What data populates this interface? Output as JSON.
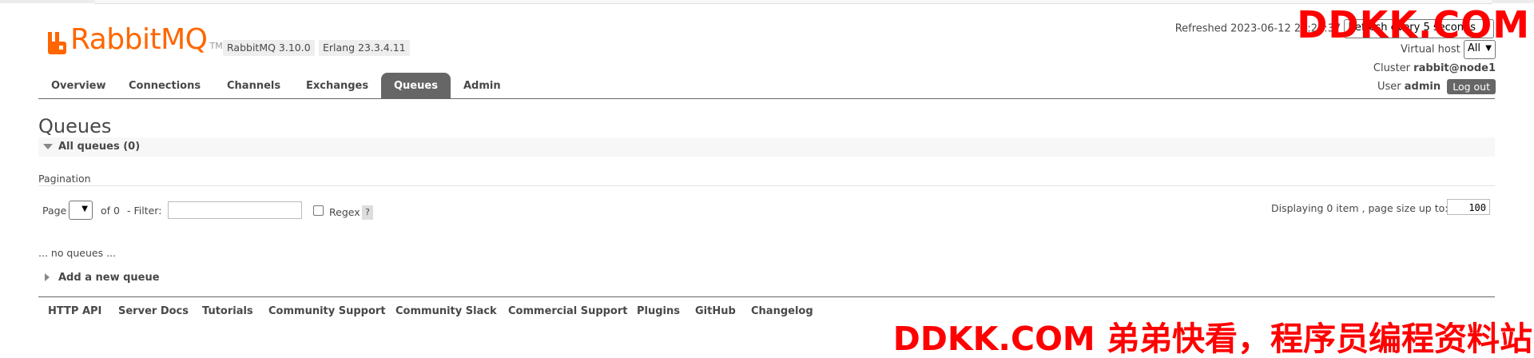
{
  "header": {
    "logo_text": "RabbitMQ",
    "logo_tm": "TM",
    "rabbitmq_version": "RabbitMQ 3.10.0",
    "erlang_version": "Erlang 23.3.4.11",
    "refreshed_label": "Refreshed 2023-06-12 23:23:37",
    "refresh_select_value": "Refresh every 5 seconds",
    "vhost_label": "Virtual host",
    "vhost_value": "All",
    "cluster_label": "Cluster",
    "cluster_value": "rabbit@node1",
    "user_label": "User",
    "user_value": "admin",
    "logout_label": "Log out"
  },
  "nav": {
    "tabs": [
      {
        "label": "Overview"
      },
      {
        "label": "Connections"
      },
      {
        "label": "Channels"
      },
      {
        "label": "Exchanges"
      },
      {
        "label": "Queues",
        "active": true
      },
      {
        "label": "Admin"
      }
    ]
  },
  "main": {
    "title": "Queues",
    "section_label": "All queues (0)",
    "pagination_label": "Pagination",
    "page_label": "Page",
    "of_label": "of 0",
    "filter_label": "- Filter:",
    "filter_value": "",
    "regex_label": "Regex",
    "help_label": "?",
    "displaying_label": "Displaying 0 item , page size up to:",
    "page_size_value": "100",
    "empty_text": "... no queues ...",
    "add_queue_label": "Add a new queue"
  },
  "footer": {
    "links": [
      "HTTP API",
      "Server Docs",
      "Tutorials",
      "Community Support",
      "Community Slack",
      "Commercial Support",
      "Plugins",
      "GitHub",
      "Changelog"
    ]
  },
  "watermarks": {
    "top": "DDKK.COM",
    "bottom": "DDKK.COM 弟弟快看，程序员编程资料站"
  },
  "colors": {
    "brand": "#ff6600",
    "tab_active_bg": "#666666",
    "watermark": "#ff0000"
  }
}
